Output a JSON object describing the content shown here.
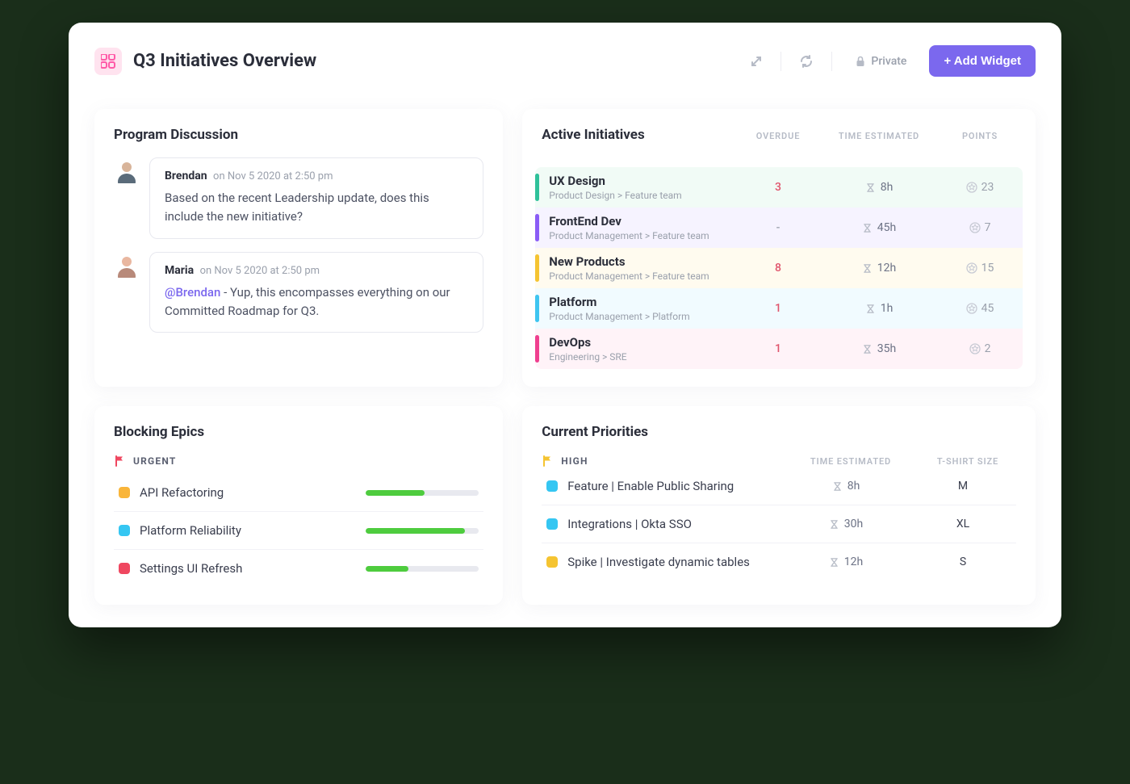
{
  "header": {
    "title": "Q3 Initiatives Overview",
    "privacy_label": "Private",
    "add_widget_label": "+ Add Widget"
  },
  "discussion": {
    "title": "Program Discussion",
    "items": [
      {
        "author": "Brendan",
        "meta": "on Nov 5 2020 at 2:50 pm",
        "avatar_bg": "#d8b49a",
        "text": "Based on the recent Leadership update, does this include the new initiative?"
      },
      {
        "author": "Maria",
        "meta": "on Nov 5 2020 at 2:50 pm",
        "avatar_bg": "#e9b7a0",
        "mention": "@Brendan",
        "text": " - Yup, this encompasses everything on our Committed Roadmap for Q3."
      }
    ]
  },
  "active": {
    "title": "Active Initiatives",
    "cols": {
      "overdue": "OVERDUE",
      "time": "TIME ESTIMATED",
      "points": "POINTS"
    },
    "rows": [
      {
        "stripe": "#2fc19a",
        "bg": "#f1fbf6",
        "name": "UX Design",
        "path": "Product Design > Feature team",
        "overdue": "3",
        "time": "8h",
        "points": "23"
      },
      {
        "stripe": "#8a5cf6",
        "bg": "#f6f3ff",
        "name": "FrontEnd Dev",
        "path": "Product Management > Feature team",
        "overdue": "-",
        "time": "45h",
        "points": "7"
      },
      {
        "stripe": "#f5c431",
        "bg": "#fffbef",
        "name": "New Products",
        "path": "Product Management > Feature team",
        "overdue": "8",
        "time": "12h",
        "points": "15"
      },
      {
        "stripe": "#3ec5f0",
        "bg": "#f1fbff",
        "name": "Platform",
        "path": "Product Management > Platform",
        "overdue": "1",
        "time": "1h",
        "points": "45"
      },
      {
        "stripe": "#ef3f8f",
        "bg": "#fff3f8",
        "name": "DevOps",
        "path": "Engineering > SRE",
        "overdue": "1",
        "time": "35h",
        "points": "2"
      }
    ]
  },
  "blocking": {
    "title": "Blocking Epics",
    "flag_label": "URGENT",
    "rows": [
      {
        "color": "#f9b53a",
        "name": "API Refactoring",
        "progress": 52
      },
      {
        "color": "#35c6f2",
        "name": "Platform Reliability",
        "progress": 88
      },
      {
        "color": "#ef4760",
        "name": "Settings UI Refresh",
        "progress": 38
      }
    ]
  },
  "priorities": {
    "title": "Current Priorities",
    "flag_label": "HIGH",
    "cols": {
      "time": "TIME ESTIMATED",
      "size": "T-SHIRT SIZE"
    },
    "rows": [
      {
        "color": "#35c6f2",
        "name": "Feature | Enable Public Sharing",
        "time": "8h",
        "size": "M"
      },
      {
        "color": "#35c6f2",
        "name": "Integrations | Okta SSO",
        "time": "30h",
        "size": "XL"
      },
      {
        "color": "#f5c431",
        "name": "Spike | Investigate dynamic tables",
        "time": "12h",
        "size": "S"
      }
    ]
  }
}
